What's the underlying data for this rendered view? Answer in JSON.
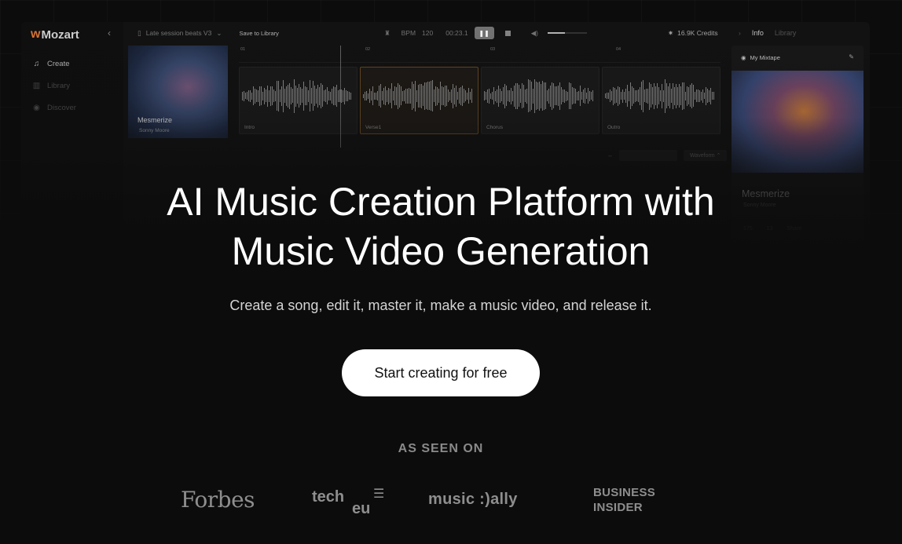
{
  "app_preview": {
    "brand": "Mozart",
    "sidebar": {
      "items": [
        {
          "label": "Create",
          "icon": "music-note-icon"
        },
        {
          "label": "Library",
          "icon": "library-icon"
        },
        {
          "label": "Discover",
          "icon": "compass-icon"
        }
      ]
    },
    "topbar": {
      "project_name": "Late session beats V3",
      "save_label": "Save to Library",
      "bpm_label": "BPM",
      "bpm_value": "120",
      "time": "00:23.1",
      "volume_fraction": 0.45,
      "credits": "16.9K Credits",
      "tab_info": "Info",
      "tab_library": "Library"
    },
    "track": {
      "title": "Mesmerize",
      "artist": "Sonny Moore"
    },
    "timeline": {
      "ruler": [
        "01",
        "02",
        "03",
        "04"
      ],
      "sections": [
        "Intro",
        "Verse1",
        "Chorus",
        "Outro"
      ],
      "view_mode": "Waveform"
    },
    "info_panel": {
      "playlist": "My Mixtape",
      "title": "Mesmerize",
      "artist": "Sonny Moore",
      "likes": "175",
      "comments": "13",
      "share_label": "Share"
    }
  },
  "hero": {
    "title_line1": "AI Music Creation Platform with",
    "title_line2": "Music Video Generation",
    "subtitle": "Create a song, edit it, master it, make a music video, and release it.",
    "cta_label": "Start creating for free"
  },
  "press": {
    "heading": "AS SEEN ON",
    "logos": {
      "forbes": "Forbes",
      "tech": "tech",
      "eu": "eu",
      "music_ally_a": "music",
      "music_ally_b": ":)ally",
      "bi_line1": "BUSINESS",
      "bi_line2": "INSIDER"
    }
  },
  "colors": {
    "background": "#0c0c0c",
    "accent": "#e0783a",
    "cta_bg": "#ffffff"
  }
}
